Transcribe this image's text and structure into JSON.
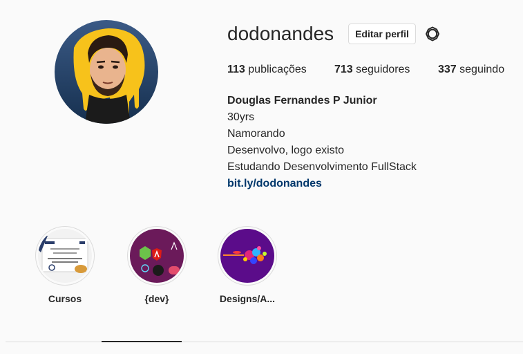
{
  "profile": {
    "username": "dodonandes",
    "edit_label": "Editar perfil",
    "settings_icon": "gear-icon"
  },
  "stats": {
    "posts_count": "113",
    "posts_label": "publicações",
    "followers_count": "713",
    "followers_label": "seguidores",
    "following_count": "337",
    "following_label": "seguindo"
  },
  "bio": {
    "full_name": "Douglas Fernandes P Junior",
    "lines": [
      "30yrs",
      "Namorando",
      "Desenvolvo, logo existo",
      "Estudando Desenvolvimento FullStack"
    ],
    "link": "bit.ly/dodonandes"
  },
  "highlights": [
    {
      "label": "Cursos"
    },
    {
      "label": "{dev}"
    },
    {
      "label": "Designs/A..."
    }
  ],
  "colors": {
    "link": "#00376b",
    "border": "#dbdbdb",
    "avatar_bg": "#1f3d63",
    "avatar_accent": "#f7c21b"
  }
}
